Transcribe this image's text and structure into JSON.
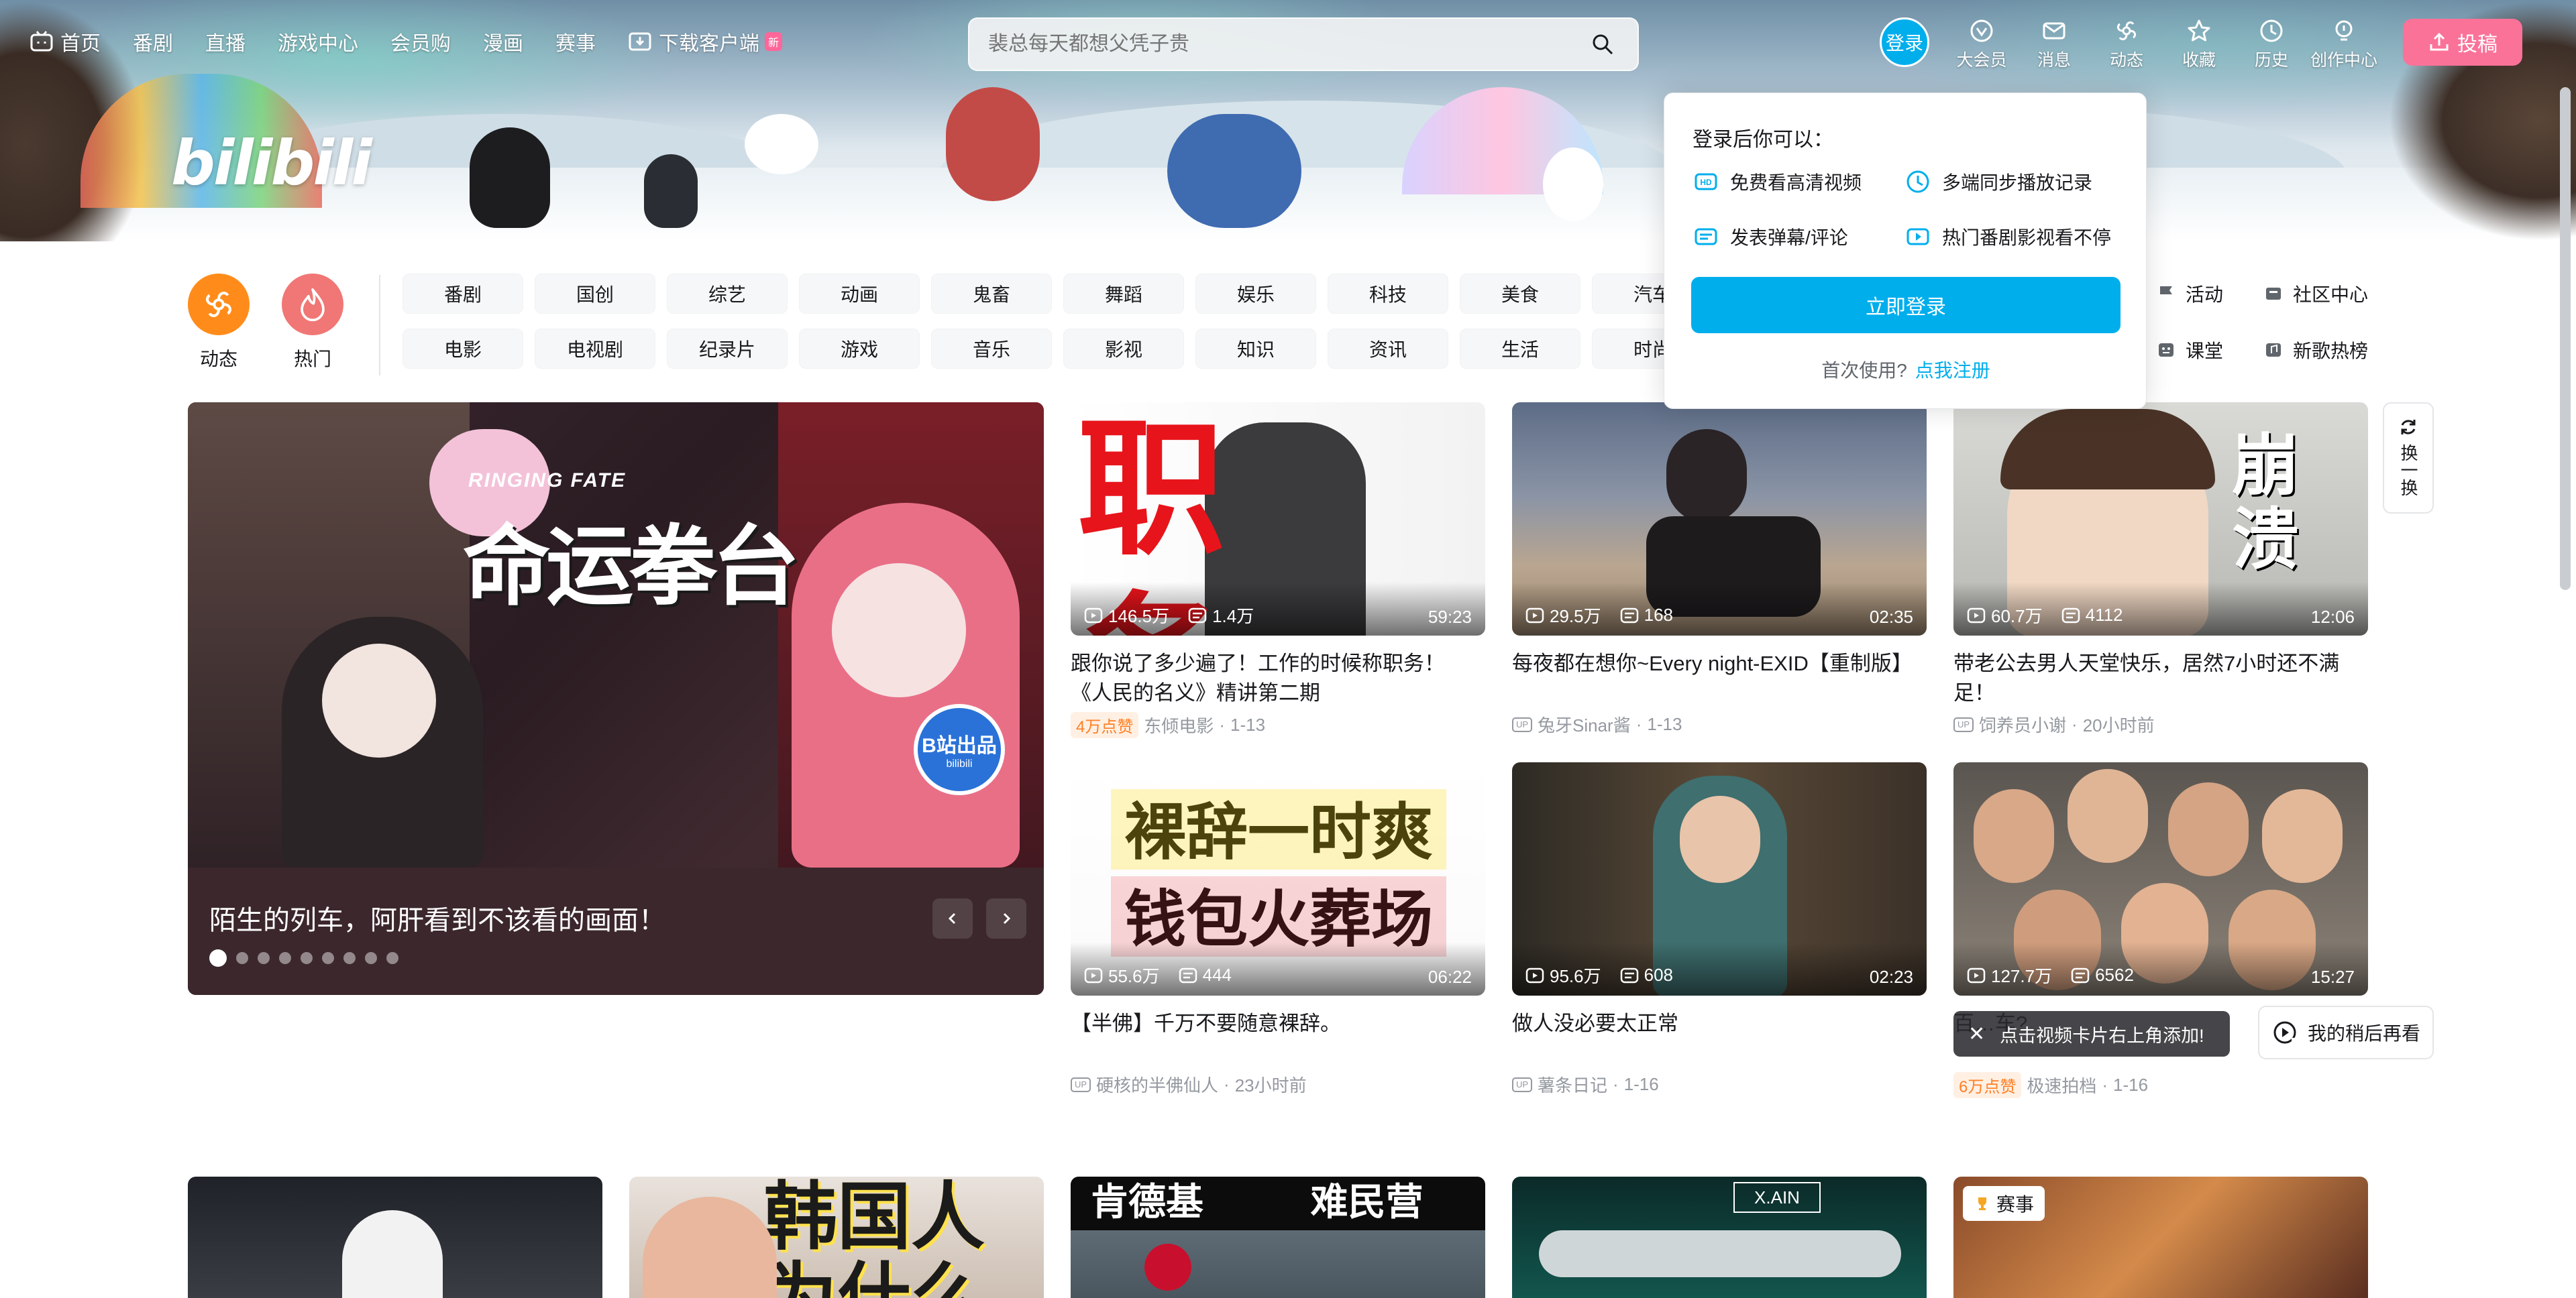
{
  "nav": {
    "items": [
      {
        "label": "首页",
        "icon": "tv-icon"
      },
      {
        "label": "番剧"
      },
      {
        "label": "直播"
      },
      {
        "label": "游戏中心"
      },
      {
        "label": "会员购"
      },
      {
        "label": "漫画"
      },
      {
        "label": "赛事"
      },
      {
        "label": "下载客户端",
        "icon": "download-icon",
        "badge": "新"
      }
    ]
  },
  "brand": {
    "logo": "bilibili"
  },
  "search": {
    "placeholder": "裴总每天都想父凭子贵"
  },
  "user": {
    "login_label": "登录",
    "right_nav": [
      {
        "label": "大会员",
        "icon": "vip-icon"
      },
      {
        "label": "消息",
        "icon": "mail-icon"
      },
      {
        "label": "动态",
        "icon": "feed-icon"
      },
      {
        "label": "收藏",
        "icon": "star-icon"
      },
      {
        "label": "历史",
        "icon": "clock-icon"
      },
      {
        "label": "创作中心",
        "icon": "bulb-icon"
      }
    ],
    "upload_label": "投稿"
  },
  "quick": {
    "dynamic": "动态",
    "hot": "热门"
  },
  "channels": {
    "row1": [
      "番剧",
      "国创",
      "综艺",
      "动画",
      "鬼畜",
      "舞蹈",
      "娱乐",
      "科技",
      "美食",
      "汽车"
    ],
    "row2": [
      "电影",
      "电视剧",
      "纪录片",
      "游戏",
      "音乐",
      "影视",
      "知识",
      "资讯",
      "生活",
      "时尚"
    ],
    "side": [
      {
        "label": "活动",
        "icon": "flag-icon"
      },
      {
        "label": "社区中心",
        "icon": "community-icon"
      },
      {
        "label": "课堂",
        "icon": "classroom-icon"
      },
      {
        "label": "新歌热榜",
        "icon": "music-chart-icon"
      }
    ]
  },
  "login_popup": {
    "heading": "登录后你可以：",
    "features": [
      "免费看高清视频",
      "多端同步播放记录",
      "发表弹幕/评论",
      "热门番剧影视看不停"
    ],
    "button": "立即登录",
    "first_time": "首次使用?",
    "register": "点我注册"
  },
  "carousel": {
    "title": "陌生的列车，阿肝看到不该看的画面！",
    "art_text": "命运拳台",
    "art_sub": "RINGING FATE",
    "badge": "B站出品",
    "badge_sub": "bilibili",
    "slides": 9,
    "active_slide": 1
  },
  "refresh": {
    "label": "换一换"
  },
  "videos": [
    {
      "title": "跟你说了多少遍了！工作的时候称职务！《人民的名义》精讲第二期",
      "views": "146.5万",
      "danmaku": "1.4万",
      "duration": "59:23",
      "likes": "4万点赞",
      "author": "东倾电影",
      "date": "1-13",
      "thumb_text": "职 务"
    },
    {
      "title": "每夜都在想你~Every night-EXID【重制版】",
      "views": "29.5万",
      "danmaku": "168",
      "duration": "02:35",
      "likes": "",
      "author": "兔牙Sinar酱",
      "date": "1-13",
      "thumb_text": ""
    },
    {
      "title": "带老公去男人天堂快乐，居然7小时还不满足！",
      "views": "60.7万",
      "danmaku": "4112",
      "duration": "12:06",
      "likes": "",
      "author": "饲养员小谢",
      "date": "20小时前",
      "thumb_text": "崩溃"
    },
    {
      "title": "【半佛】千万不要随意裸辞。",
      "views": "55.6万",
      "danmaku": "444",
      "duration": "06:22",
      "likes": "",
      "author": "硬核的半佛仙人",
      "date": "23小时前",
      "thumb_text": "裸辞一时爽 钱包火葬场"
    },
    {
      "title": "做人没必要太正常",
      "views": "95.6万",
      "danmaku": "608",
      "duration": "02:23",
      "likes": "",
      "author": "薯条日记",
      "date": "1-16",
      "thumb_text": ""
    },
    {
      "title": "百…车?",
      "views": "127.7万",
      "danmaku": "6562",
      "duration": "15:27",
      "likes": "6万点赞",
      "author": "极速拍档",
      "date": "1-16",
      "thumb_text": ""
    }
  ],
  "bottom_row": [
    {
      "thumb_text": ""
    },
    {
      "thumb_text": "韩国人 为什么"
    },
    {
      "thumb_text": "肯德基 难民营"
    },
    {
      "thumb_text": "X.AIN"
    },
    {
      "thumb_text": "",
      "tag": "赛事"
    }
  ],
  "toast": {
    "text": "点击视频卡片右上角添加!"
  },
  "watch_later": {
    "label": "我的稍后再看"
  },
  "colors": {
    "brand_blue": "#00aeec",
    "brand_pink": "#fb7299",
    "dynamic_orange": "#ff8c1a",
    "hot_red": "#f07775"
  }
}
